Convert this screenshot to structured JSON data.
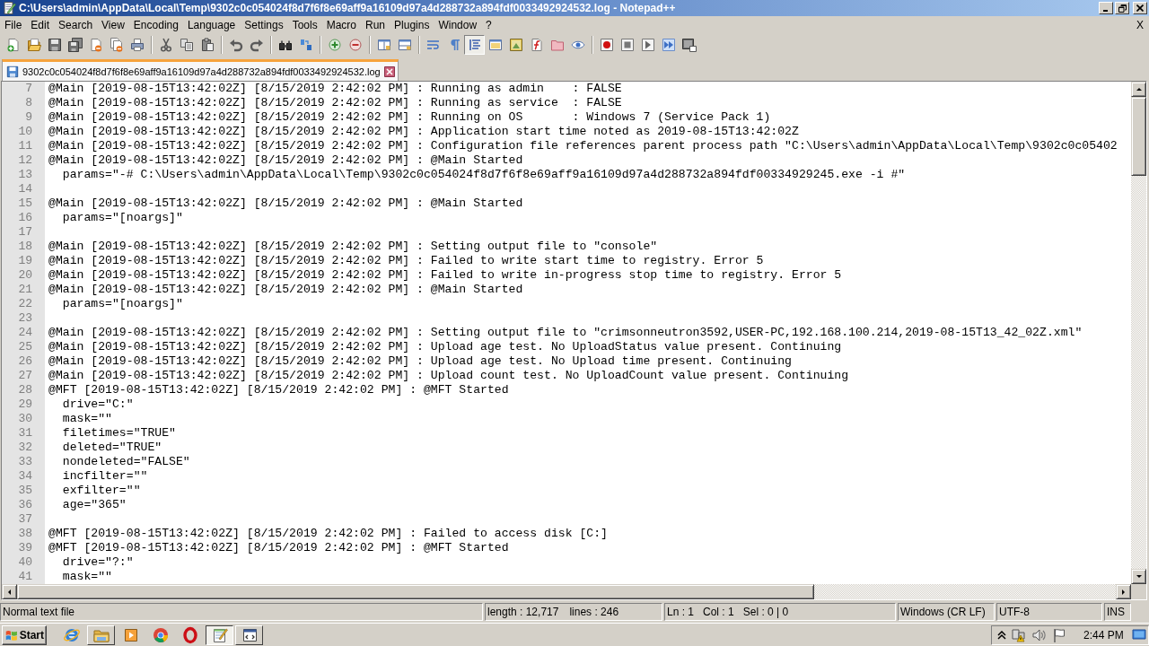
{
  "window": {
    "title": "C:\\Users\\admin\\AppData\\Local\\Temp\\9302c0c054024f8d7f6f8e69aff9a16109d97a4d288732a894fdf0033492924532.log - Notepad++"
  },
  "menu": {
    "items": [
      "File",
      "Edit",
      "Search",
      "View",
      "Encoding",
      "Language",
      "Settings",
      "Tools",
      "Macro",
      "Run",
      "Plugins",
      "Window",
      "?"
    ],
    "close": "X"
  },
  "toolbar": [
    {
      "buttons": [
        {
          "kind": "new",
          "on": false
        },
        {
          "kind": "open",
          "on": false
        },
        {
          "kind": "save",
          "on": false
        },
        {
          "kind": "save_all",
          "on": false
        },
        {
          "kind": "close",
          "on": false
        },
        {
          "kind": "close_all",
          "on": false
        },
        {
          "kind": "print",
          "on": false
        }
      ]
    },
    {
      "buttons": [
        {
          "kind": "cut",
          "on": false
        },
        {
          "kind": "copy",
          "on": false
        },
        {
          "kind": "paste",
          "on": false
        }
      ]
    },
    {
      "buttons": [
        {
          "kind": "undo",
          "on": false
        },
        {
          "kind": "redo",
          "on": false
        }
      ]
    },
    {
      "buttons": [
        {
          "kind": "find",
          "on": false
        },
        {
          "kind": "replace",
          "on": false
        }
      ]
    },
    {
      "buttons": [
        {
          "kind": "zoom_in",
          "on": false
        },
        {
          "kind": "zoom_out",
          "on": false
        }
      ]
    },
    {
      "buttons": [
        {
          "kind": "sync_vertical",
          "on": false
        },
        {
          "kind": "sync_horizontal",
          "on": false
        }
      ]
    },
    {
      "buttons": [
        {
          "kind": "wrap",
          "on": false
        },
        {
          "kind": "all_chars",
          "on": false
        },
        {
          "kind": "indent_guide",
          "on": true
        },
        {
          "kind": "udl",
          "on": false
        },
        {
          "kind": "doc_map",
          "on": false
        },
        {
          "kind": "function_list",
          "on": false
        },
        {
          "kind": "folder_workspace",
          "on": false
        },
        {
          "kind": "monitoring",
          "on": false
        }
      ]
    },
    {
      "buttons": [
        {
          "kind": "record",
          "on": false
        },
        {
          "kind": "stop",
          "on": false
        },
        {
          "kind": "play",
          "on": false
        },
        {
          "kind": "play_multiple",
          "on": false
        },
        {
          "kind": "save_macro",
          "on": false
        }
      ]
    }
  ],
  "tabs": [
    {
      "label": "9302c0c054024f8d7f6f8e69aff9a16109d97a4d288732a894fdf0033492924532.log",
      "selected": true
    }
  ],
  "editor": {
    "lines": [
      {
        "number": "7",
        "text": "@Main [2019-08-15T13:42:02Z] [8/15/2019 2:42:02 PM] : Running as admin    : FALSE"
      },
      {
        "number": "8",
        "text": "@Main [2019-08-15T13:42:02Z] [8/15/2019 2:42:02 PM] : Running as service  : FALSE"
      },
      {
        "number": "9",
        "text": "@Main [2019-08-15T13:42:02Z] [8/15/2019 2:42:02 PM] : Running on OS       : Windows 7 (Service Pack 1)"
      },
      {
        "number": "10",
        "text": "@Main [2019-08-15T13:42:02Z] [8/15/2019 2:42:02 PM] : Application start time noted as 2019-08-15T13:42:02Z"
      },
      {
        "number": "11",
        "text": "@Main [2019-08-15T13:42:02Z] [8/15/2019 2:42:02 PM] : Configuration file references parent process path \"C:\\Users\\admin\\AppData\\Local\\Temp\\9302c0c05402"
      },
      {
        "number": "12",
        "text": "@Main [2019-08-15T13:42:02Z] [8/15/2019 2:42:02 PM] : @Main Started"
      },
      {
        "number": "13",
        "text": "  params=\"-# C:\\Users\\admin\\AppData\\Local\\Temp\\9302c0c054024f8d7f6f8e69aff9a16109d97a4d288732a894fdf00334929245.exe -i #\""
      },
      {
        "number": "14"
      },
      {
        "number": "15",
        "text": "@Main [2019-08-15T13:42:02Z] [8/15/2019 2:42:02 PM] : @Main Started"
      },
      {
        "number": "16",
        "text": "  params=\"[noargs]\""
      },
      {
        "number": "17"
      },
      {
        "number": "18",
        "text": "@Main [2019-08-15T13:42:02Z] [8/15/2019 2:42:02 PM] : Setting output file to \"console\""
      },
      {
        "number": "19",
        "text": "@Main [2019-08-15T13:42:02Z] [8/15/2019 2:42:02 PM] : Failed to write start time to registry. Error 5"
      },
      {
        "number": "20",
        "text": "@Main [2019-08-15T13:42:02Z] [8/15/2019 2:42:02 PM] : Failed to write in-progress stop time to registry. Error 5"
      },
      {
        "number": "21",
        "text": "@Main [2019-08-15T13:42:02Z] [8/15/2019 2:42:02 PM] : @Main Started"
      },
      {
        "number": "22",
        "text": "  params=\"[noargs]\""
      },
      {
        "number": "23"
      },
      {
        "number": "24",
        "text": "@Main [2019-08-15T13:42:02Z] [8/15/2019 2:42:02 PM] : Setting output file to \"crimsonneutron3592,USER-PC,192.168.100.214,2019-08-15T13_42_02Z.xml\""
      },
      {
        "number": "25",
        "text": "@Main [2019-08-15T13:42:02Z] [8/15/2019 2:42:02 PM] : Upload age test. No UploadStatus value present. Continuing"
      },
      {
        "number": "26",
        "text": "@Main [2019-08-15T13:42:02Z] [8/15/2019 2:42:02 PM] : Upload age test. No Upload time present. Continuing"
      },
      {
        "number": "27",
        "text": "@Main [2019-08-15T13:42:02Z] [8/15/2019 2:42:02 PM] : Upload count test. No UploadCount value present. Continuing"
      },
      {
        "number": "28",
        "text": "@MFT [2019-08-15T13:42:02Z] [8/15/2019 2:42:02 PM] : @MFT Started"
      },
      {
        "number": "29",
        "text": "  drive=\"C:\""
      },
      {
        "number": "30",
        "text": "  mask=\"\""
      },
      {
        "number": "31",
        "text": "  filetimes=\"TRUE\""
      },
      {
        "number": "32",
        "text": "  deleted=\"TRUE\""
      },
      {
        "number": "33",
        "text": "  nondeleted=\"FALSE\""
      },
      {
        "number": "34",
        "text": "  incfilter=\"\""
      },
      {
        "number": "35",
        "text": "  exfilter=\"\""
      },
      {
        "number": "36",
        "text": "  age=\"365\""
      },
      {
        "number": "37"
      },
      {
        "number": "38",
        "text": "@MFT [2019-08-15T13:42:02Z] [8/15/2019 2:42:02 PM] : Failed to access disk [C:]"
      },
      {
        "number": "39",
        "text": "@MFT [2019-08-15T13:42:02Z] [8/15/2019 2:42:02 PM] : @MFT Started"
      },
      {
        "number": "40",
        "text": "  drive=\"?:\""
      },
      {
        "number": "41",
        "text": "  mask=\"\""
      }
    ]
  },
  "status_bar": {
    "file_type": "Normal text file",
    "length": "length : 12,717",
    "lines": "lines : 246",
    "line": "Ln : 1",
    "column": "Col : 1",
    "selection": "Sel : 0 | 0",
    "line_endings": "Windows (CR LF)",
    "encoding": "UTF-8",
    "mode": "INS"
  },
  "taskbar": {
    "start": "Start",
    "apps": [
      {
        "kind": "globe",
        "running": false,
        "active": false
      },
      {
        "kind": "folder",
        "running": true,
        "active": false
      },
      {
        "kind": "media",
        "running": false,
        "active": false
      },
      {
        "kind": "tricolor",
        "running": false,
        "active": false
      },
      {
        "kind": "ring",
        "running": false,
        "active": false
      },
      {
        "kind": "notepad",
        "running": true,
        "active": true
      },
      {
        "kind": "window",
        "running": true,
        "active": false
      }
    ],
    "clock": "2:44 PM"
  }
}
